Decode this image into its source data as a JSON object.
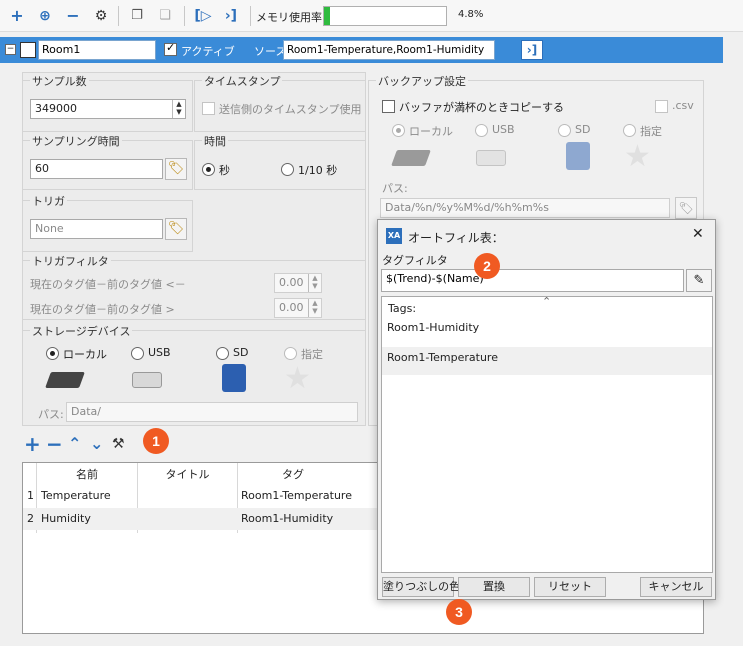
{
  "toolbar": {
    "memory_label": "メモリ使用率",
    "memory_value": "4.8%",
    "memory_fraction": 0.048
  },
  "header": {
    "name": "Room1",
    "active_label": "アクティブ",
    "source_label": "ソース",
    "source_value": "Room1-Temperature,Room1-Humidity"
  },
  "left": {
    "sample_count_label": "サンプル数",
    "sample_count_value": "349000",
    "timestamp_label": "タイムスタンプ",
    "timestamp_sender": "送信側のタイムスタンプ使用",
    "sampling_time_label": "サンプリング時間",
    "sampling_time_value": "60",
    "time_label": "時間",
    "time_sec": "秒",
    "time_tenth": "1/10 秒",
    "trigger_label": "トリガ",
    "trigger_value": "None",
    "trigger_filter_label": "トリガフィルタ",
    "filter_row1_label": "現在のタグ値－前のタグ値 <－",
    "filter_row1_value": "0.00",
    "filter_row2_label": "現在のタグ値－前のタグ値 >",
    "filter_row2_value": "0.00",
    "storage_label": "ストレージデバイス",
    "storage_local": "ローカル",
    "storage_usb": "USB",
    "storage_sd": "SD",
    "storage_custom": "指定",
    "path_label": "パス:",
    "path_value": "Data/"
  },
  "backup": {
    "title": "バックアップ設定",
    "copy_when_full": "バッファが満杯のときコピーする",
    "csv": ".csv",
    "local": "ローカル",
    "usb": "USB",
    "sd": "SD",
    "custom": "指定",
    "path_label": "パス:",
    "path_value": "Data/%n/%y%M%d/%h%m%s"
  },
  "table": {
    "columns": [
      "名前",
      "タイトル",
      "タグ"
    ],
    "rows": [
      {
        "index": "1",
        "name": "Temperature",
        "title": "",
        "tag": "Room1-Temperature"
      },
      {
        "index": "2",
        "name": "Humidity",
        "title": "",
        "tag": "Room1-Humidity"
      }
    ]
  },
  "dialog": {
    "title": "オートフィル表：",
    "close": "✕",
    "tag_filter_label": "タグフィルタ",
    "tag_filter_value": "$(Trend)-$(Name)",
    "tags_header": "Tags:",
    "tags": [
      "Room1-Humidity",
      "Room1-Temperature"
    ],
    "buttons": {
      "fill": "塗りつぶしの色",
      "replace": "置換",
      "reset": "リセット",
      "cancel": "キャンセル"
    }
  },
  "badges": [
    "1",
    "2",
    "3"
  ],
  "colors": {
    "header_blue": "#3a8bd8",
    "memory_green": "#2fbb3f",
    "badge_orange": "#f05a22",
    "icon_blue": "#2c6fbb"
  }
}
